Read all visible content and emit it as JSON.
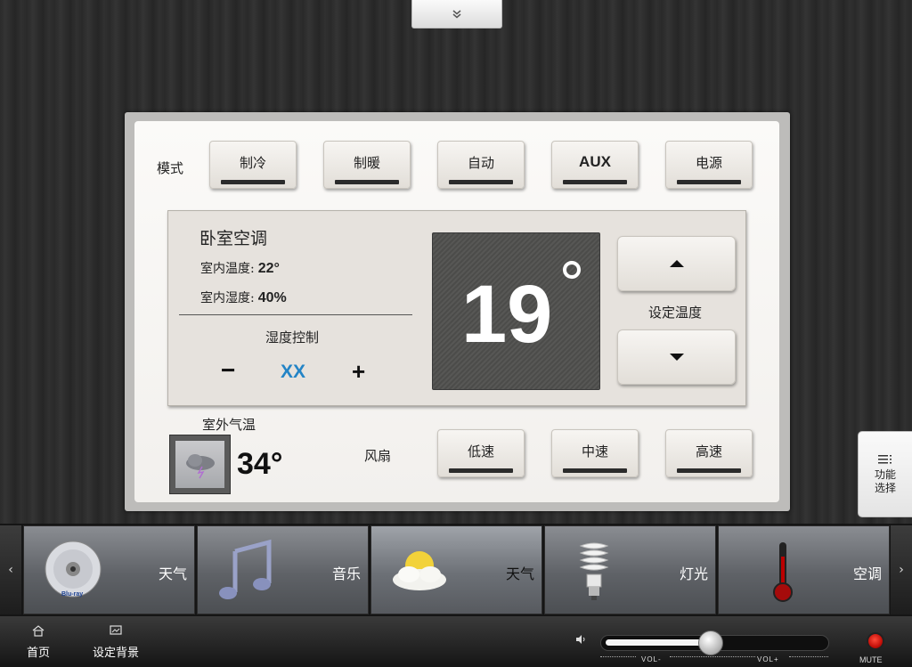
{
  "top_tab": {
    "icon": "double-chevron-down-icon",
    "glyph": "⌄"
  },
  "mode": {
    "label": "模式",
    "buttons": [
      "制冷",
      "制暖",
      "自动",
      "AUX",
      "电源"
    ]
  },
  "room": {
    "name": "卧室空调",
    "indoor_temp_label": "室内温度:",
    "indoor_temp_value": "22°",
    "indoor_humidity_label": "室内湿度:",
    "indoor_humidity_value": "40%",
    "humidity_control_label": "湿度控制",
    "humidity_minus": "−",
    "humidity_value": "XX",
    "humidity_plus": "+"
  },
  "setpoint": {
    "temperature": "19",
    "label": "设定温度"
  },
  "outdoor": {
    "label": "室外气温",
    "temperature": "34°"
  },
  "fan": {
    "label": "风扇",
    "buttons": [
      "低速",
      "中速",
      "高速"
    ]
  },
  "side_panel": {
    "line1": "功能",
    "line2": "选择"
  },
  "tiles": [
    {
      "label": "天气",
      "icon": "bluray-disc-icon"
    },
    {
      "label": "音乐",
      "icon": "music-note-icon"
    },
    {
      "label": "天气",
      "icon": "weather-sun-cloud-icon"
    },
    {
      "label": "灯光",
      "icon": "light-bulb-icon"
    },
    {
      "label": "空调",
      "icon": "thermometer-icon"
    }
  ],
  "footer": {
    "home_label": "首页",
    "background_label": "设定背景",
    "vol_minus": "VOL-",
    "vol_plus": "VOL+",
    "mute": "MUTE",
    "volume_level": 0.48
  },
  "colors": {
    "humidity_value": "#2384c6",
    "mute_red": "#e0150c"
  }
}
